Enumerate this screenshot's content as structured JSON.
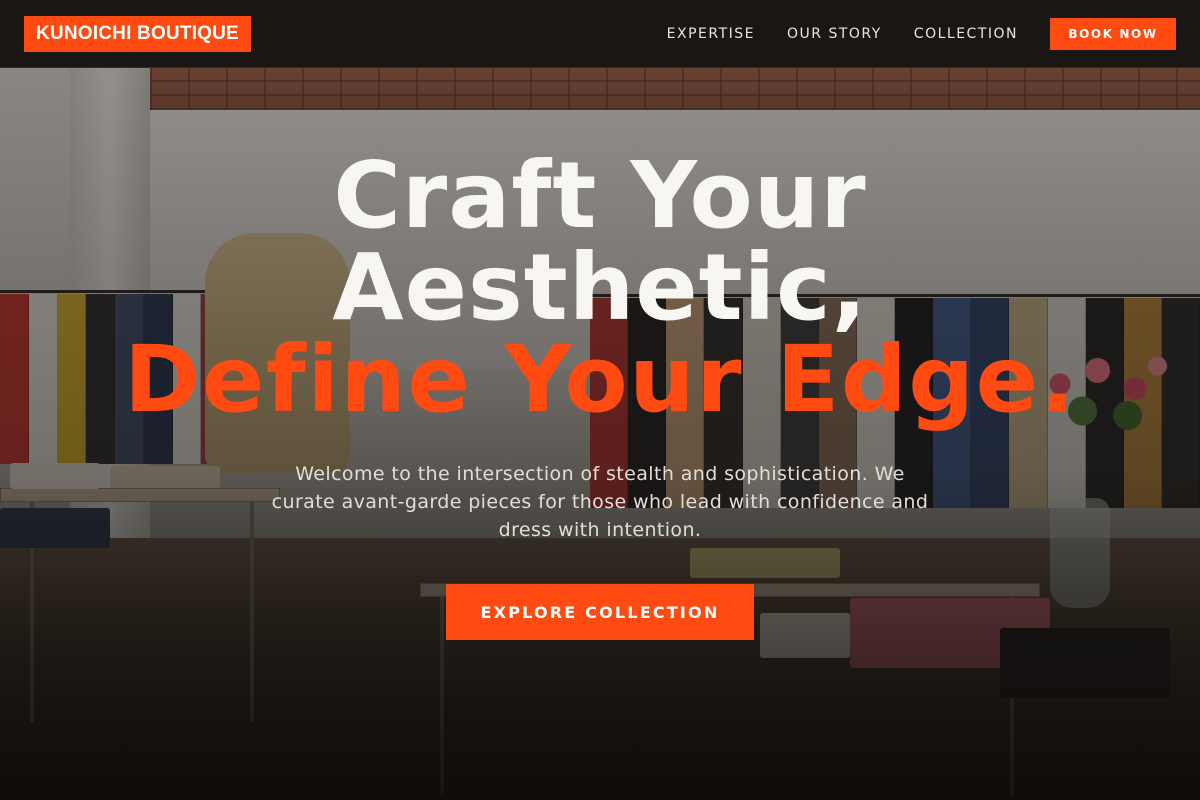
{
  "brand": {
    "name": "KUNOICHI BOUTIQUE",
    "accent_color": "#ff4a12",
    "nav_bg": "#1a1614"
  },
  "nav": {
    "links": [
      {
        "label": "EXPERTISE"
      },
      {
        "label": "OUR STORY"
      },
      {
        "label": "COLLECTION"
      }
    ],
    "cta_label": "BOOK NOW"
  },
  "hero": {
    "headline_line1": "Craft Your",
    "headline_line2": "Aesthetic,",
    "headline_accent": "Define Your Edge.",
    "tagline": "Welcome to the intersection of stealth and sophistication. We curate avant-garde pieces for those who lead with confidence and dress with intention.",
    "cta_label": "EXPLORE COLLECTION",
    "background_description": "boutique-interior-photo"
  }
}
